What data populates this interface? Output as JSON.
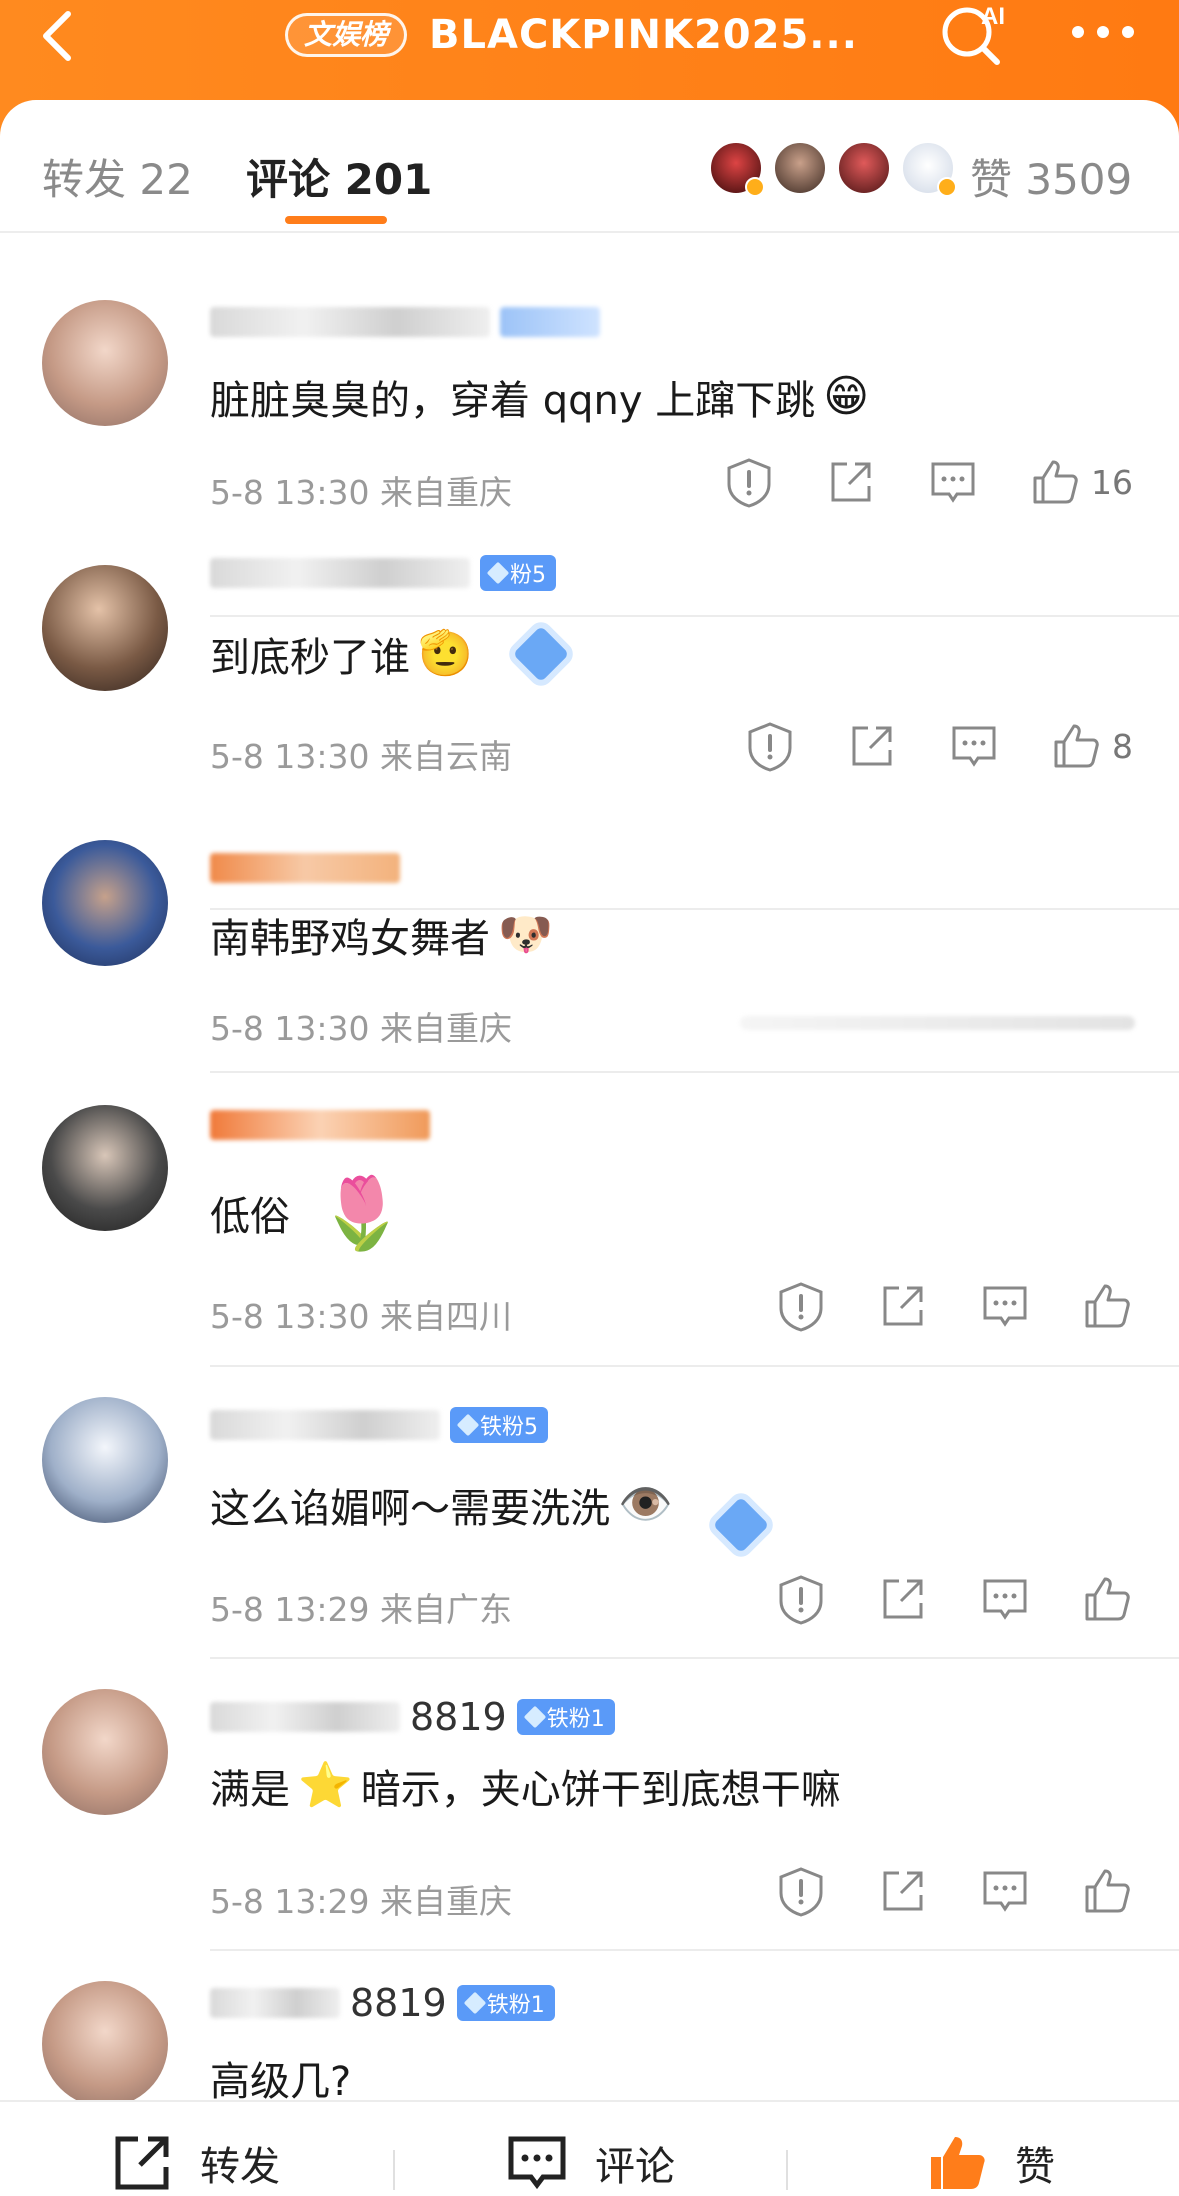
{
  "header": {
    "topic_badge": "文娱榜",
    "title": "BLACKPINK2025...",
    "ai_label": "AI"
  },
  "tabs": {
    "forward": "转发 22",
    "comments": "评论 201",
    "likes": "赞 3509"
  },
  "colors": {
    "brand": "#ff7d1a",
    "fan_badge": "#5a9af8",
    "meta_text": "#9a9a9a"
  },
  "comments": [
    {
      "text": "脏脏臭臭的，穿着 qqny 上蹿下跳",
      "emoji": "😁",
      "time": "5-8 13:30",
      "location": "来自重庆",
      "likes": "16"
    },
    {
      "text": "到底秒了谁",
      "emoji": "🫡",
      "time": "5-8 13:30",
      "location": "来自云南",
      "likes": "8",
      "badge": "粉5"
    },
    {
      "text": "南韩野鸡女舞者",
      "emoji": "🐶",
      "time": "5-8 13:30",
      "location": "来自重庆"
    },
    {
      "text": "低俗",
      "emoji": "🌷",
      "time": "5-8 13:30",
      "location": "来自四川"
    },
    {
      "text": "这么谄媚啊～需要洗洗",
      "emoji": "👁️",
      "time": "5-8 13:29",
      "location": "来自广东",
      "badge": "铁粉5"
    },
    {
      "username_suffix": "8819",
      "text_before": "满是",
      "emoji": "⭐",
      "text": "暗示，夹心饼干到底想干嘛",
      "time": "5-8 13:29",
      "location": "来自重庆",
      "badge": "铁粉1"
    },
    {
      "username_suffix": "8819",
      "text": "高级几?",
      "badge": "铁粉1"
    }
  ],
  "bottom_bar": {
    "forward": "转发",
    "comment": "评论",
    "like": "赞"
  },
  "icons": [
    "back-icon",
    "ai-search-icon",
    "more-icon",
    "report-icon",
    "share-icon",
    "reply-icon",
    "thumbs-up-icon"
  ]
}
